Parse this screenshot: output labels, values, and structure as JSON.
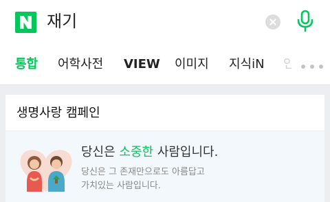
{
  "search": {
    "logo_letter": "N",
    "query": "재기"
  },
  "tabs": [
    {
      "label": "통합",
      "active": true
    },
    {
      "label": "어학사전",
      "active": false
    },
    {
      "label": "VIEW",
      "active": false
    },
    {
      "label": "이미지",
      "active": false
    },
    {
      "label": "지식iN",
      "active": false
    }
  ],
  "tabs_overflow": "인",
  "campaign": {
    "title": "생명사랑 캠페인",
    "headline_prefix": "당신은 ",
    "headline_highlight": "소중한",
    "headline_suffix": " 사람입니다.",
    "subtext_line1": "당신은 그 존재만으로도 아름답고",
    "subtext_line2": "가치있는 사람입니다."
  },
  "colors": {
    "brand_green": "#03c75a",
    "card_body_bg": "#f2f8fc"
  },
  "icons": {
    "logo": "naver-n-logo",
    "clear": "clear-icon",
    "mic": "microphone-icon",
    "more": "more-dots-icon"
  }
}
